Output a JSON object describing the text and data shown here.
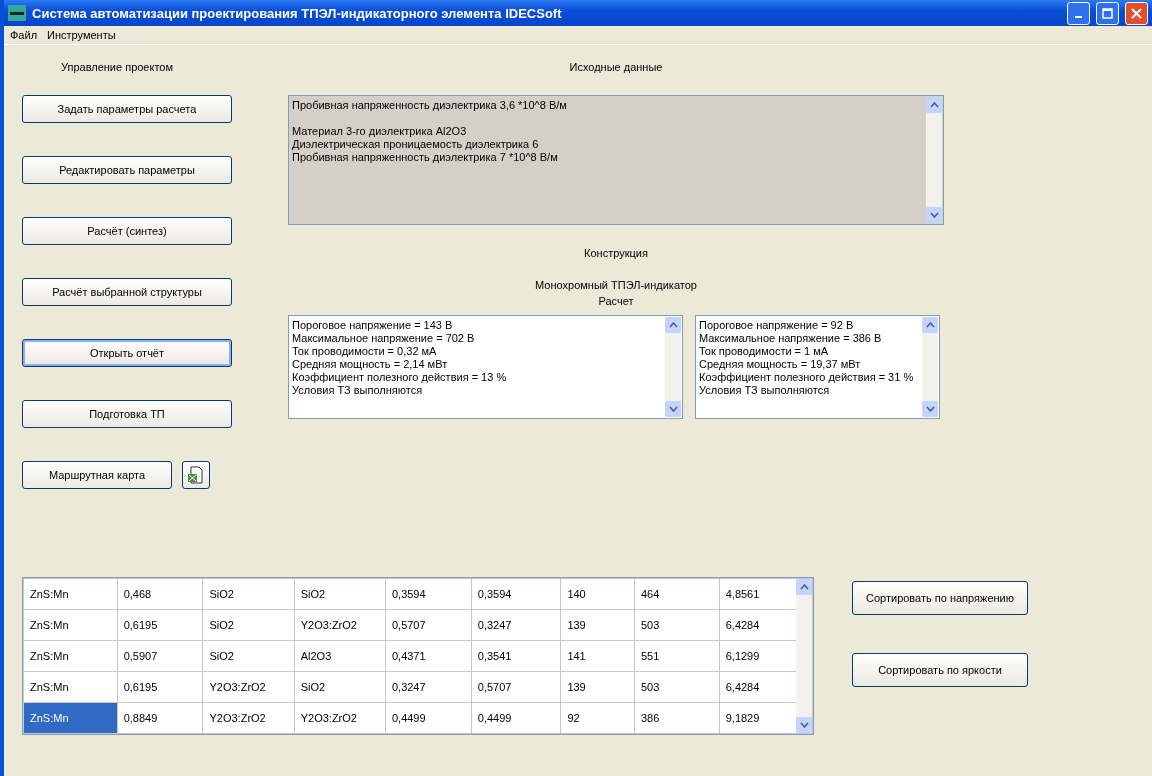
{
  "window": {
    "title": "Система автоматизации проектирования ТПЭЛ-индикаторного элемента IDECSoft"
  },
  "menu": [
    "Файл",
    "Инструменты"
  ],
  "project_panel": {
    "title": "Управление проектом",
    "buttons": [
      {
        "label": "Задать параметры расчета",
        "focused": false
      },
      {
        "label": "Редактировать параметры",
        "focused": false
      },
      {
        "label": "Расчёт (синтез)",
        "focused": false
      },
      {
        "label": "Расчёт выбранной структуры",
        "focused": false
      },
      {
        "label": "Открыть отчёт",
        "focused": true
      },
      {
        "label": "Подготовка ТП",
        "focused": false
      },
      {
        "label": "Маршрутная карта",
        "focused": false
      }
    ]
  },
  "source_data": {
    "title": "Исходные данные",
    "paragraphs": [
      [
        "Пробивная напряженность диэлектрика 3,6 *10^8 В/м"
      ],
      [
        "Материал 3-го диэлектрика Al2O3",
        "Диэлектрическая проницаемость диэлектрика 6",
        "Пробивная напряженность диэлектрика 7 *10^8 В/м"
      ]
    ]
  },
  "construction": {
    "title": "Конструкция",
    "subtitle": "Монохромный ТПЭЛ-индикатор",
    "calc_title": "Расчет"
  },
  "results": [
    {
      "lines": [
        "Пороговое напряжение = 143 В",
        "Максимальное напряжение = 702 В",
        "Ток проводимости = 0,32 мА",
        "Средняя мощность = 2,14  мВт",
        "Коэффициент полезного действия = 13 %",
        " Условия ТЗ выполняются"
      ]
    },
    {
      "lines": [
        "Пороговое напряжение = 92 В",
        "Максимальное напряжение = 386 В",
        "Ток проводимости = 1 мА",
        "Средняя мощность = 19,37  мВт",
        "Коэффициент полезного действия = 31 %",
        " Условия ТЗ выполняются"
      ]
    }
  ],
  "table": {
    "rows": [
      {
        "cells": [
          "ZnS:Mn",
          "0,468",
          "SiO2",
          "SiO2",
          "0,3594",
          "0,3594",
          "140",
          "464",
          "4,8561"
        ],
        "selected": false
      },
      {
        "cells": [
          "ZnS:Mn",
          "0,6195",
          "SiO2",
          "Y2O3:ZrO2",
          "0,5707",
          "0,3247",
          "139",
          "503",
          "6,4284"
        ],
        "selected": false
      },
      {
        "cells": [
          "ZnS:Mn",
          "0,5907",
          "SiO2",
          "Al2O3",
          "0,4371",
          "0,3541",
          "141",
          "551",
          "6,1299"
        ],
        "selected": false
      },
      {
        "cells": [
          "ZnS:Mn",
          "0,6195",
          "Y2O3:ZrO2",
          "SiO2",
          "0,3247",
          "0,5707",
          "139",
          "503",
          "6,4284"
        ],
        "selected": false
      },
      {
        "cells": [
          "ZnS:Mn",
          "0,8849",
          "Y2O3:ZrO2",
          "Y2O3:ZrO2",
          "0,4499",
          "0,4499",
          "92",
          "386",
          "9,1829"
        ],
        "selected": true
      }
    ]
  },
  "sort_buttons": [
    "Сортировать по напряжению",
    "Сортировать по яркости"
  ]
}
